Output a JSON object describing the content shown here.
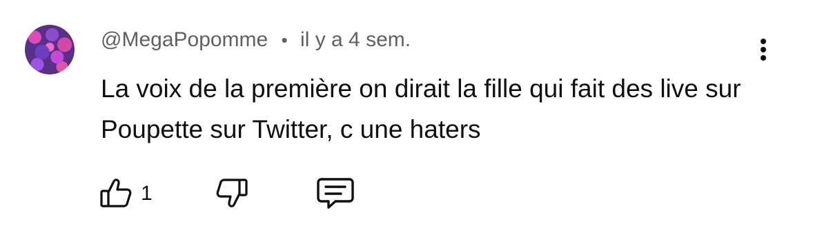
{
  "comment": {
    "author": "@MegaPopomme",
    "separator": "•",
    "time": "il y a 4 sem.",
    "text": "La voix de la première on dirait la fille qui fait des live sur Poupette sur Twitter, c une haters",
    "likes": "1"
  },
  "icons": {
    "like": "thumbs-up-icon",
    "dislike": "thumbs-down-icon",
    "reply": "comment-icon",
    "menu": "more-vertical-icon"
  },
  "colors": {
    "text": "#0f0f0f",
    "meta": "#606060"
  }
}
